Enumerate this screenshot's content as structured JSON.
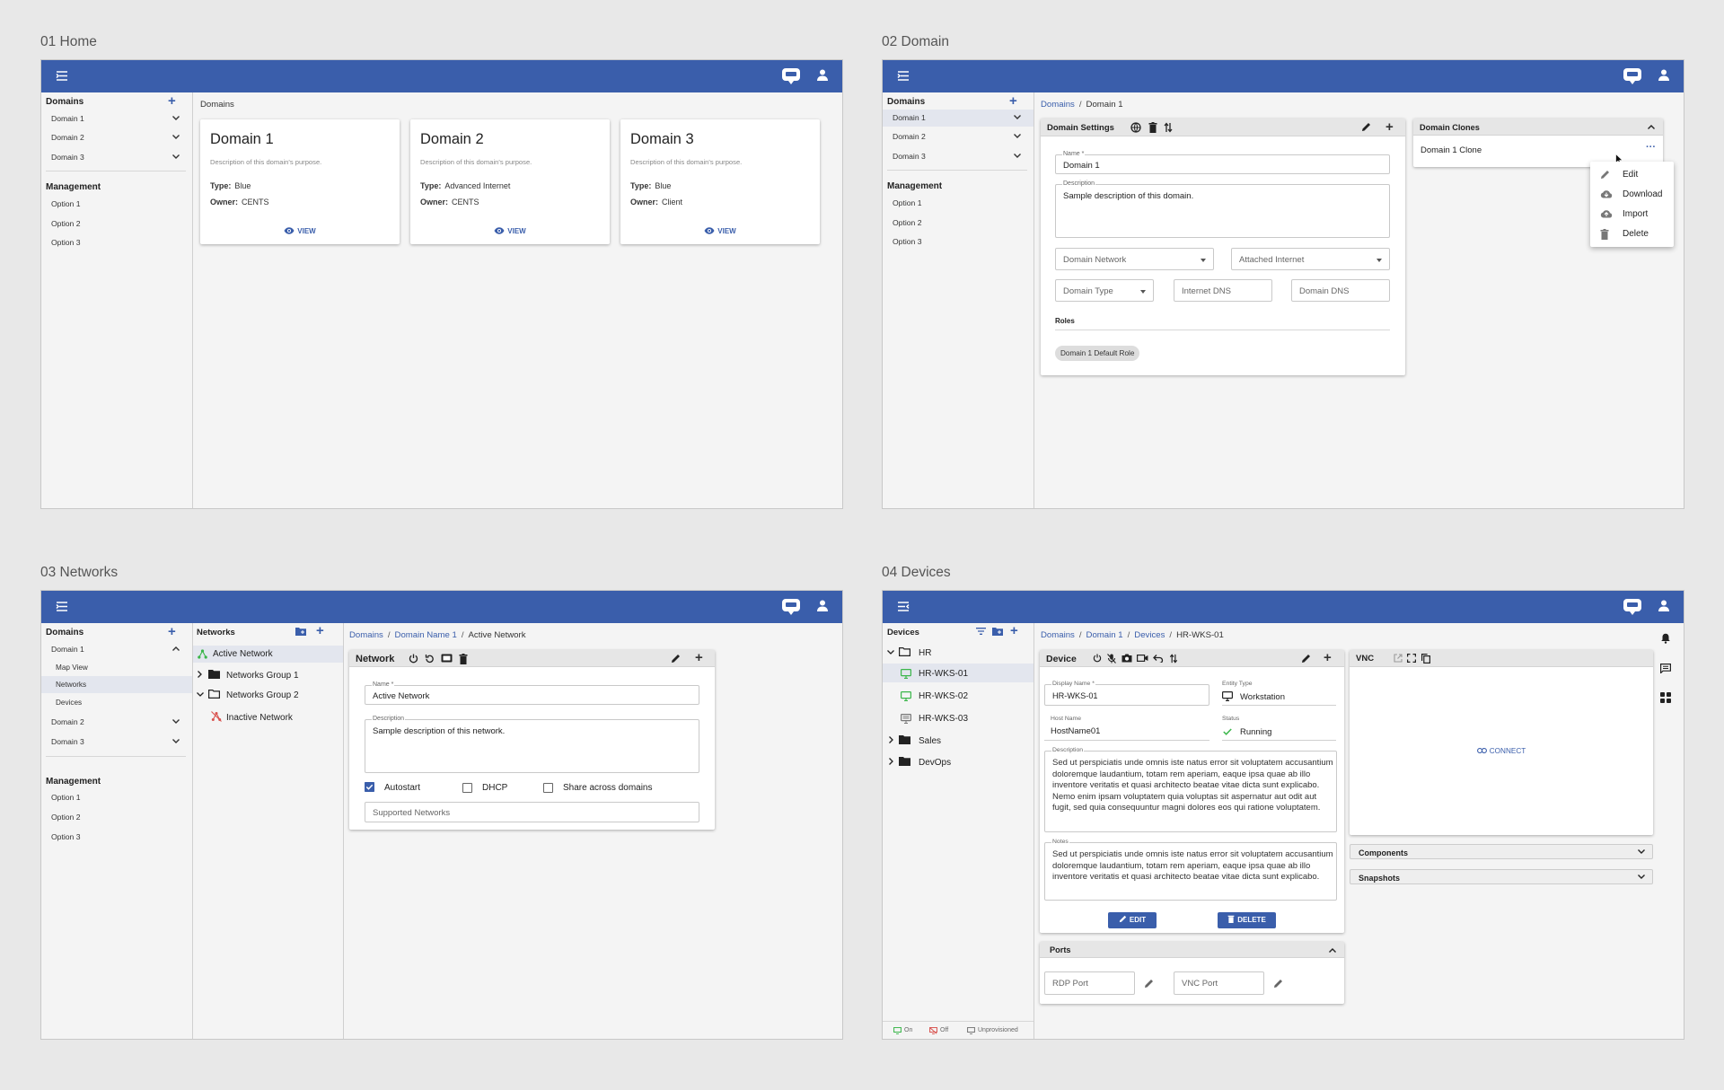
{
  "boards": [
    {
      "title": "01 Home"
    },
    {
      "title": "02 Domain"
    },
    {
      "title": "03 Networks"
    },
    {
      "title": "04 Devices"
    }
  ],
  "home": {
    "sidebar": {
      "domains_heading": "Domains",
      "domains": [
        "Domain 1",
        "Domain 2",
        "Domain 3"
      ],
      "management_heading": "Management",
      "options": [
        "Option 1",
        "Option 2",
        "Option 3"
      ]
    },
    "breadcrumb": "Domains",
    "cards": [
      {
        "title": "Domain 1",
        "description": "Description of this domain's purpose.",
        "type_label": "Type:",
        "type": "Blue",
        "owner_label": "Owner:",
        "owner": "CENTS",
        "view": "VIEW"
      },
      {
        "title": "Domain 2",
        "description": "Description of this domain's purpose.",
        "type_label": "Type:",
        "type": "Advanced Internet",
        "owner_label": "Owner:",
        "owner": "CENTS",
        "view": "VIEW"
      },
      {
        "title": "Domain 3",
        "description": "Description of this domain's purpose.",
        "type_label": "Type:",
        "type": "Blue",
        "owner_label": "Owner:",
        "owner": "Client",
        "view": "VIEW"
      }
    ]
  },
  "domain": {
    "sidebar": {
      "domains_heading": "Domains",
      "domains": [
        "Domain 1",
        "Domain 2",
        "Domain 3"
      ],
      "management_heading": "Management",
      "options": [
        "Option 1",
        "Option 2",
        "Option 3"
      ]
    },
    "breadcrumb": {
      "root": "Domains",
      "current": "Domain 1"
    },
    "settings": {
      "title": "Domain Settings",
      "name_label": "Name *",
      "name_value": "Domain 1",
      "description_label": "Description",
      "description_value": "Sample description of this domain.",
      "domain_network": "Domain Network",
      "attached_internet": "Attached Internet",
      "domain_type": "Domain Type",
      "internet_dns": "Internet DNS",
      "domain_dns": "Domain DNS",
      "roles_heading": "Roles",
      "role_chip": "Domain 1 Default Role"
    },
    "clones": {
      "title": "Domain Clones",
      "item": "Domain 1 Clone",
      "menu": [
        "Edit",
        "Download",
        "Import",
        "Delete"
      ]
    }
  },
  "networks": {
    "sidebar": {
      "domains_heading": "Domains",
      "domain1": "Domain 1",
      "sub": [
        "Map View",
        "Networks",
        "Devices"
      ],
      "domains_rest": [
        "Domain 2",
        "Domain 3"
      ],
      "management_heading": "Management",
      "options": [
        "Option 1",
        "Option 2",
        "Option 3"
      ]
    },
    "tree": {
      "heading": "Networks",
      "items": [
        "Active Network",
        "Networks Group 1",
        "Networks Group 2",
        "Inactive Network"
      ]
    },
    "breadcrumb": {
      "root": "Domains",
      "mid": "Domain Name 1",
      "current": "Active Network"
    },
    "pane": {
      "title": "Network",
      "name_label": "Name *",
      "name_value": "Active Network",
      "description_label": "Description",
      "description_value": "Sample description of this network.",
      "autostart": "Autostart",
      "dhcp": "DHCP",
      "share": "Share across domains",
      "supported": "Supported Networks"
    }
  },
  "devices": {
    "tree": {
      "heading": "Devices",
      "groups": [
        "HR",
        "Sales",
        "DevOps"
      ],
      "hosts": [
        "HR-WKS-01",
        "HR-WKS-02",
        "HR-WKS-03"
      ],
      "legend": [
        "On",
        "Off",
        "Unprovisioned"
      ]
    },
    "breadcrumb": {
      "root": "Domains",
      "mid1": "Domain 1",
      "mid2": "Devices",
      "current": "HR-WKS-01"
    },
    "pane": {
      "title": "Device",
      "display_name_label": "Display Name *",
      "display_name_value": "HR-WKS-01",
      "entity_type_label": "Entity Type",
      "entity_type_value": "Workstation",
      "host_name_label": "Host Name",
      "host_name_value": "HostName01",
      "status_label": "Status",
      "status_value": "Running",
      "description_label": "Description",
      "description_value": "Sed ut perspiciatis unde omnis iste natus error sit voluptatem accusantium doloremque laudantium, totam rem aperiam, eaque ipsa quae ab illo inventore veritatis et quasi architecto beatae vitae dicta sunt explicabo. Nemo enim ipsam voluptatem quia voluptas sit aspernatur aut odit aut fugit, sed quia consequuntur magni dolores eos qui ratione voluptatem.",
      "notes_label": "Notes",
      "notes_value": "Sed ut perspiciatis unde omnis iste natus error sit voluptatem accusantium doloremque laudantium, totam rem aperiam, eaque ipsa quae ab illo inventore veritatis et quasi architecto beatae vitae dicta sunt explicabo.",
      "edit": "EDIT",
      "delete": "DELETE"
    },
    "ports": {
      "title": "Ports",
      "rdp": "RDP Port",
      "vnc": "VNC Port"
    },
    "vnc": {
      "title": "VNC",
      "connect": "CONNECT"
    },
    "accordions": [
      "Components",
      "Snapshots"
    ]
  },
  "colors": {
    "primary": "#3a5eab",
    "green": "#3bb64a",
    "red": "#d9534f"
  }
}
